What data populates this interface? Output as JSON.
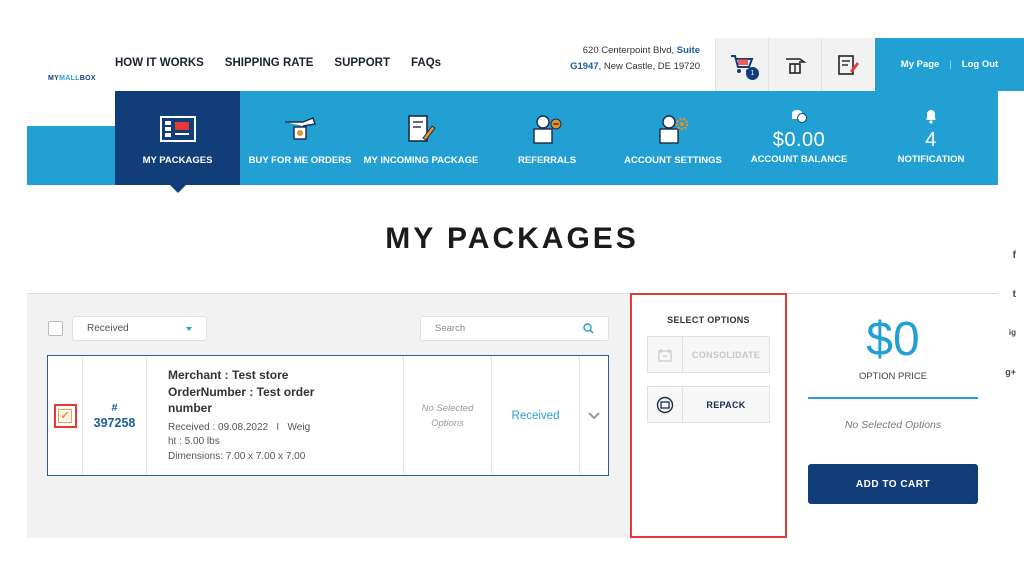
{
  "logo": {
    "part1": "MY",
    "part2": "MALL",
    "part3": "BOX"
  },
  "top_nav": [
    "HOW IT WORKS",
    "SHIPPING RATE",
    "SUPPORT",
    "FAQs"
  ],
  "address": {
    "line1": "620 Centerpoint Blvd, ",
    "suite_a": "Suite",
    "suite_b": "G1947",
    "line2": ", New Castle, DE 19720"
  },
  "cart_badge": "1",
  "account": {
    "my_page": "My Page",
    "separator": "|",
    "log_out": "Log Out"
  },
  "main_nav": {
    "my_packages": "MY PACKAGES",
    "buy_for_me": "BUY FOR ME ORDERS",
    "incoming": "MY INCOMING PACKAGE",
    "referrals": "REFERRALS",
    "account_settings": "ACCOUNT SETTINGS",
    "balance_value": "$0.00",
    "balance_label": "ACCOUNT BALANCE",
    "notification_count": "4",
    "notification_label": "NOTIFICATION"
  },
  "page_title": "MY PACKAGES",
  "social": [
    "f",
    "t",
    "ig",
    "g+"
  ],
  "filter": {
    "selected": "Received",
    "search_placeholder": "Search"
  },
  "package": {
    "hash": "#",
    "id": "397258",
    "merchant_line1": "Merchant : Test store",
    "merchant_line2": "OrderNumber : Test order",
    "merchant_line3": "number",
    "received_line1": "Received : 09.08.2022   I   Weig",
    "received_line2": "ht : 5.00 lbs",
    "dimensions": "Dimensions: 7.00 x 7.00 x 7.00",
    "options_line1": "No Selected",
    "options_line2": "Options",
    "status": "Received",
    "checked": true
  },
  "select_options": {
    "title": "SELECT OPTIONS",
    "consolidate": "CONSOLIDATE",
    "repack": "REPACK"
  },
  "summary": {
    "price": "$0",
    "price_label": "OPTION PRICE",
    "no_selected": "No Selected Options",
    "add_to_cart": "ADD TO CART"
  },
  "colors": {
    "primary": "#22a0d3",
    "dark": "#113e78",
    "highlight": "#e53935"
  }
}
